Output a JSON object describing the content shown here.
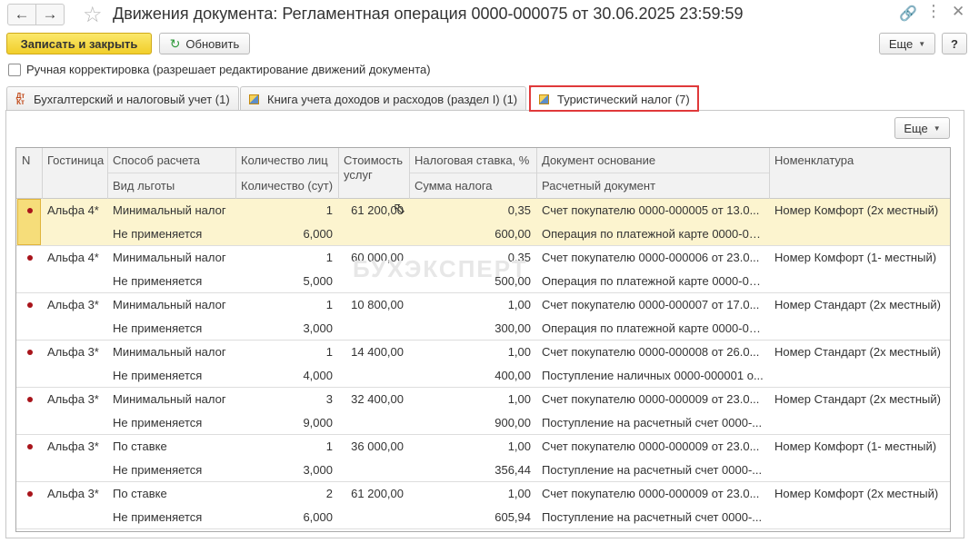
{
  "window": {
    "title": "Движения документа: Регламентная операция 0000-000075 от 30.06.2025 23:59:59"
  },
  "toolbar": {
    "save_close": "Записать и закрыть",
    "refresh": "Обновить",
    "more": "Еще",
    "help": "?"
  },
  "manual_edit": {
    "checked": false,
    "label": "Ручная корректировка (разрешает редактирование движений документа)"
  },
  "tabs": [
    {
      "label": "Бухгалтерский и налоговый учет (1)",
      "icon": "dt-kt-icon"
    },
    {
      "label": "Книга учета доходов и расходов (раздел I) (1)",
      "icon": "register-book-icon"
    },
    {
      "label": "Туристический налог (7)",
      "icon": "register-book-icon",
      "active": true
    }
  ],
  "grid": {
    "more": "Еще",
    "headers": {
      "n": "N",
      "hotel": "Гостиница",
      "calc_method": "Способ расчета",
      "benefit_type": "Вид льготы",
      "persons": "Количество лиц",
      "days": "Количество (сут)",
      "cost": "Стоимость услуг",
      "rate": "Налоговая ставка, %",
      "tax_sum": "Сумма налога",
      "base_doc": "Документ основание",
      "payment_doc": "Расчетный документ",
      "nomenclature": "Номенклатура"
    },
    "rows": [
      {
        "hotel": "Альфа 4*",
        "method": "Минимальный налог",
        "benefit": "Не применяется",
        "persons": "1",
        "days": "6,000",
        "cost": "61 200,00",
        "rate": "0,35",
        "tax": "600,00",
        "doc": "Счет покупателю 0000-000005 от 13.0...",
        "payment": "Операция по платежной карте 0000-00...",
        "item": "Номер Комфорт (2х местный)"
      },
      {
        "hotel": "Альфа 4*",
        "method": "Минимальный налог",
        "benefit": "Не применяется",
        "persons": "1",
        "days": "5,000",
        "cost": "60 000,00",
        "rate": "0,35",
        "tax": "500,00",
        "doc": "Счет покупателю 0000-000006 от 23.0...",
        "payment": "Операция по платежной карте 0000-00...",
        "item": "Номер Комфорт (1- местный)"
      },
      {
        "hotel": "Альфа 3*",
        "method": "Минимальный налог",
        "benefit": "Не применяется",
        "persons": "1",
        "days": "3,000",
        "cost": "10 800,00",
        "rate": "1,00",
        "tax": "300,00",
        "doc": "Счет покупателю 0000-000007 от 17.0...",
        "payment": "Операция по платежной карте 0000-00...",
        "item": "Номер Стандарт (2х местный)"
      },
      {
        "hotel": "Альфа 3*",
        "method": "Минимальный налог",
        "benefit": "Не применяется",
        "persons": "1",
        "days": "4,000",
        "cost": "14 400,00",
        "rate": "1,00",
        "tax": "400,00",
        "doc": "Счет покупателю 0000-000008 от 26.0...",
        "payment": "Поступление наличных 0000-000001 о...",
        "item": "Номер Стандарт (2х местный)"
      },
      {
        "hotel": "Альфа 3*",
        "method": "Минимальный налог",
        "benefit": "Не применяется",
        "persons": "3",
        "days": "9,000",
        "cost": "32 400,00",
        "rate": "1,00",
        "tax": "900,00",
        "doc": "Счет покупателю 0000-000009 от 23.0...",
        "payment": "Поступление на расчетный счет 0000-...",
        "item": "Номер Стандарт (2х местный)"
      },
      {
        "hotel": "Альфа 3*",
        "method": "По ставке",
        "benefit": "Не применяется",
        "persons": "1",
        "days": "3,000",
        "cost": "36 000,00",
        "rate": "1,00",
        "tax": "356,44",
        "doc": "Счет покупателю 0000-000009 от 23.0...",
        "payment": "Поступление на расчетный счет 0000-...",
        "item": "Номер Комфорт (1- местный)"
      },
      {
        "hotel": "Альфа 3*",
        "method": "По ставке",
        "benefit": "Не применяется",
        "persons": "2",
        "days": "6,000",
        "cost": "61 200,00",
        "rate": "1,00",
        "tax": "605,94",
        "doc": "Счет покупателю 0000-000009 от 23.0...",
        "payment": "Поступление на расчетный счет 0000-...",
        "item": "Номер Комфорт (2х местный)"
      }
    ]
  },
  "watermark": "БУХЭКСПЕРТ",
  "colors": {
    "primary_button": "#f4d641",
    "selected_row": "#fcf4cf",
    "tab_highlight": "#e0393a",
    "row_marker": "#a8141b"
  }
}
